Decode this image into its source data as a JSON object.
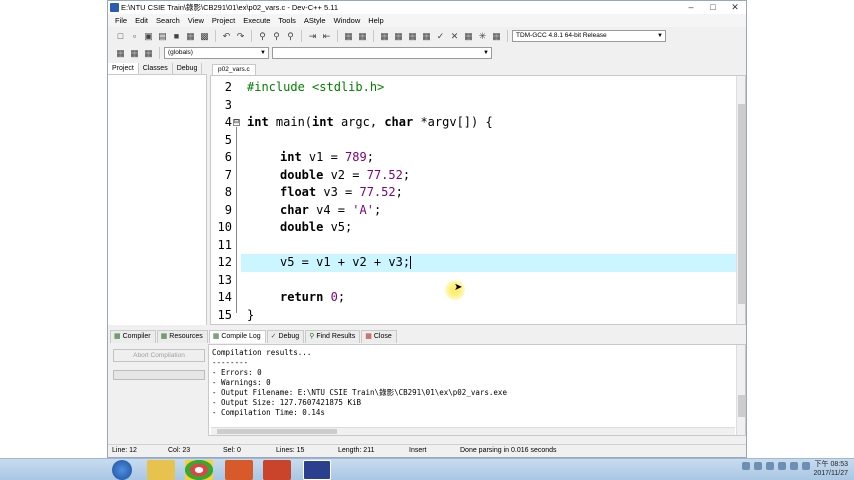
{
  "window": {
    "title": "E:\\NTU CSIE Train\\錄影\\CB291\\01\\ex\\p02_vars.c - Dev-C++ 5.11"
  },
  "menu": [
    "File",
    "Edit",
    "Search",
    "View",
    "Project",
    "Execute",
    "Tools",
    "AStyle",
    "Window",
    "Help"
  ],
  "toolbar": {
    "compiler_select": "TDM-GCC 4.8.1 64-bit Release",
    "scope_select": "(globals)"
  },
  "left_tabs": [
    "Project",
    "Classes",
    "Debug"
  ],
  "editor": {
    "file_tab": "p02_vars.c",
    "line_numbers": [
      "2",
      "3",
      "4",
      "5",
      "6",
      "7",
      "8",
      "9",
      "10",
      "11",
      "12",
      "13",
      "14",
      "15"
    ],
    "fold_open": "⊟",
    "lines": {
      "l2": "#include <stdlib.h>",
      "l4": {
        "kw1": "int",
        "t1": " main(",
        "kw2": "int",
        "t2": " argc, ",
        "kw3": "char",
        "t3": " *argv[]) {"
      },
      "l6": {
        "kw": "int",
        "t": " v1 = ",
        "num": "789",
        "end": ";"
      },
      "l7": {
        "kw": "double",
        "t": " v2 = ",
        "num": "77.52",
        "end": ";"
      },
      "l8": {
        "kw": "float",
        "t": " v3 = ",
        "num": "77.52",
        "end": ";"
      },
      "l9": {
        "kw": "char",
        "t": " v4 = ",
        "str": "'A'",
        "end": ";"
      },
      "l10": {
        "kw": "double",
        "t": " v5;"
      },
      "l12": "v5 = v1 + v2 + v3;",
      "l14": {
        "kw": "return",
        "t": " ",
        "num": "0",
        "end": ";"
      },
      "l15": "}"
    }
  },
  "bottom_tabs": [
    "Compiler",
    "Resources",
    "Compile Log",
    "Debug",
    "Find Results",
    "Close"
  ],
  "bottom": {
    "abort_button": "Abort Compilation",
    "log": [
      "Compilation results...",
      "--------",
      "- Errors: 0",
      "- Warnings: 0",
      "- Output Filename: E:\\NTU CSIE Train\\錄影\\CB291\\01\\ex\\p02_vars.exe",
      "- Output Size: 127.7607421875 KiB",
      "- Compilation Time: 0.14s"
    ]
  },
  "status": {
    "line": "Line:   12",
    "col": "Col:   23",
    "sel": "Sel:   0",
    "lines": "Lines:   15",
    "length": "Length:   211",
    "mode": "Insert",
    "message": "Done parsing in 0.016 seconds"
  },
  "taskbar": {
    "time": "下午 08:53",
    "date": "2017/11/27"
  },
  "colors": {
    "current_line": "#ccf6ff",
    "preprocessor": "#008000",
    "number": "#800080"
  }
}
